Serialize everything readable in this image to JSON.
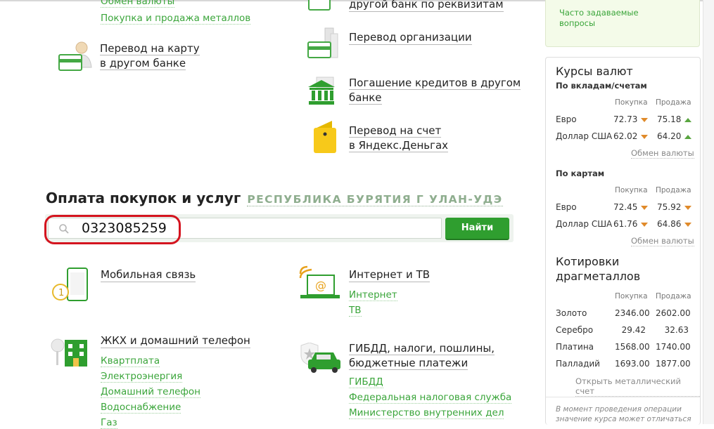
{
  "transfers_left": {
    "exchange_link": "Обмен валюты",
    "metals_link": "Покупка и продажа металлов",
    "card_transfer": {
      "line1": "Перевод на карту",
      "line2": "в другом банке"
    }
  },
  "transfers_right": {
    "other_bank": "другой банк по реквизитам",
    "org_transfer": "Перевод организации",
    "loan_repay": {
      "line1": "Погашение кредитов в другом",
      "line2": "банке"
    },
    "yandex": {
      "line1": "Перевод на счет",
      "line2": "в Яндекс.Деньгах"
    }
  },
  "payments": {
    "title": "Оплата покупок и услуг",
    "region": "РЕСПУБЛИКА БУРЯТИЯ Г УЛАН-УДЭ",
    "search_value": "0323085259",
    "search_button": "Найти"
  },
  "categories": {
    "mobile": "Мобильная связь",
    "internet_tv": "Интернет и ТВ",
    "internet_tv_links": [
      "Интернет",
      "ТВ"
    ],
    "housing": "ЖКХ и домашний телефон",
    "housing_links": [
      "Квартплата",
      "Электроэнергия",
      "Домашний телефон",
      "Водоснабжение",
      "Газ"
    ],
    "gibdd": {
      "line1": "ГИБДД, налоги, пошлины,",
      "line2": "бюджетные платежи"
    },
    "gibdd_links": [
      "ГИБДД",
      "Федеральная налоговая служба",
      "Министерство внутренних дел"
    ]
  },
  "sidebar": {
    "faq": {
      "line1": "Часто задаваемые",
      "line2": "вопросы"
    },
    "rates_title": "Курсы валют",
    "deposits_title": "По вкладам/счетам",
    "cards_title": "По картам",
    "col_buy": "Покупка",
    "col_sell": "Продажа",
    "deposit_rates": [
      {
        "name": "Евро",
        "buy": "72.73",
        "buy_dir": "down",
        "sell": "75.18",
        "sell_dir": "up"
      },
      {
        "name": "Доллар США",
        "buy": "62.02",
        "buy_dir": "down",
        "sell": "64.20",
        "sell_dir": "up"
      }
    ],
    "card_rates": [
      {
        "name": "Евро",
        "buy": "72.45",
        "buy_dir": "down",
        "sell": "75.92",
        "sell_dir": "down"
      },
      {
        "name": "Доллар США",
        "buy": "61.76",
        "buy_dir": "down",
        "sell": "64.86",
        "sell_dir": "down"
      }
    ],
    "exchange_link": "Обмен валюты",
    "metals_title": {
      "line1": "Котировки",
      "line2": "драгметаллов"
    },
    "metals": [
      {
        "name": "Золото",
        "buy": "2346.00",
        "sell": "2602.00"
      },
      {
        "name": "Серебро",
        "buy": "29.42",
        "sell": "32.63"
      },
      {
        "name": "Платина",
        "buy": "1568.00",
        "sell": "1740.00"
      },
      {
        "name": "Палладий",
        "buy": "1693.00",
        "sell": "1877.00"
      }
    ],
    "metal_account_link": "Открыть металлический счет",
    "note": {
      "line1": "В момент проведения операции",
      "line2": "значение курса может отличаться"
    }
  },
  "colors": {
    "brand_green": "#2f9e2f",
    "link_green": "#3aa53a",
    "highlight_red": "#d4141f",
    "arrow_down": "#e08a2a",
    "arrow_up": "#59a540"
  }
}
